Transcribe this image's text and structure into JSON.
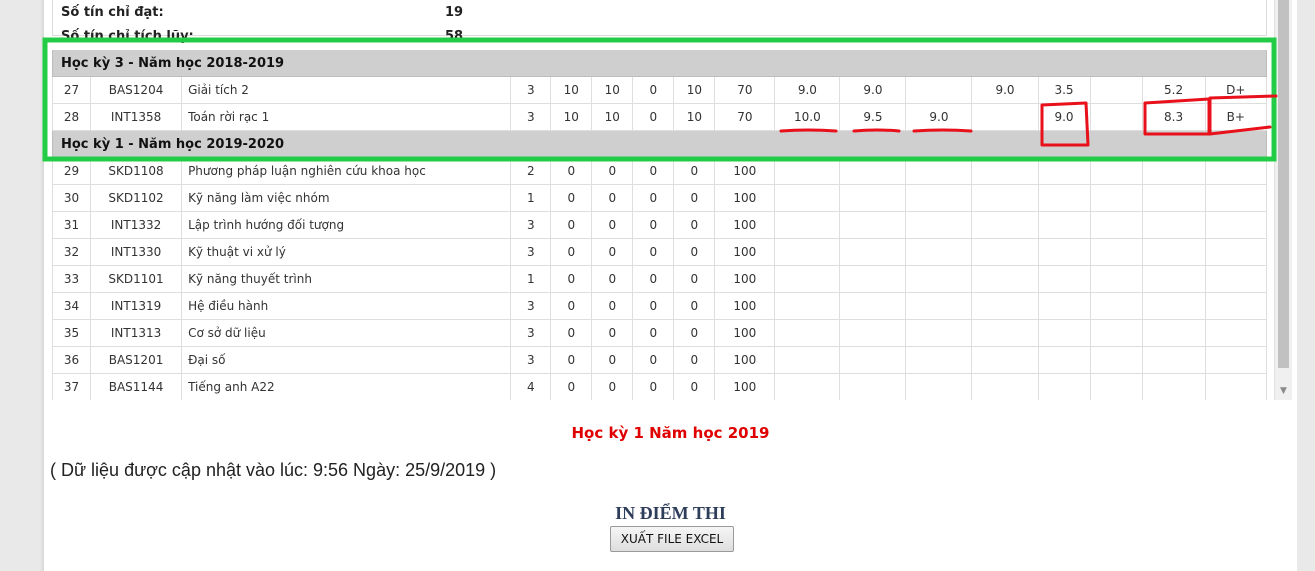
{
  "summary": [
    {
      "label": "Số tín chỉ đạt:",
      "value": "19"
    },
    {
      "label": "Số tín chỉ tích lũy:",
      "value": "58"
    }
  ],
  "semesters": [
    {
      "title": "Học kỳ 3 - Năm học 2018-2019",
      "rows": [
        {
          "stt": "27",
          "code": "BAS1204",
          "name": "Giải tích 2",
          "tc": "3",
          "w1": "10",
          "w2": "10",
          "w3": "0",
          "w4": "10",
          "w5": "70",
          "g1": "9.0",
          "g2": "9.0",
          "g3": "",
          "g4": "9.0",
          "g5": "3.5",
          "g6": "",
          "g7": "5.2",
          "letter": "D+"
        },
        {
          "stt": "28",
          "code": "INT1358",
          "name": "Toán rời rạc 1",
          "tc": "3",
          "w1": "10",
          "w2": "10",
          "w3": "0",
          "w4": "10",
          "w5": "70",
          "g1": "10.0",
          "g2": "9.5",
          "g3": "9.0",
          "g4": "",
          "g5": "9.0",
          "g6": "",
          "g7": "8.3",
          "letter": "B+"
        }
      ]
    },
    {
      "title": "Học kỳ 1 - Năm học 2019-2020",
      "rows": [
        {
          "stt": "29",
          "code": "SKD1108",
          "name": "Phương pháp luận nghiên cứu khoa học",
          "tc": "2",
          "w1": "0",
          "w2": "0",
          "w3": "0",
          "w4": "0",
          "w5": "100",
          "g1": "",
          "g2": "",
          "g3": "",
          "g4": "",
          "g5": "",
          "g6": "",
          "g7": "",
          "letter": ""
        },
        {
          "stt": "30",
          "code": "SKD1102",
          "name": "Kỹ năng làm việc nhóm",
          "tc": "1",
          "w1": "0",
          "w2": "0",
          "w3": "0",
          "w4": "0",
          "w5": "100",
          "g1": "",
          "g2": "",
          "g3": "",
          "g4": "",
          "g5": "",
          "g6": "",
          "g7": "",
          "letter": ""
        },
        {
          "stt": "31",
          "code": "INT1332",
          "name": "Lập trình hướng đối tượng",
          "tc": "3",
          "w1": "0",
          "w2": "0",
          "w3": "0",
          "w4": "0",
          "w5": "100",
          "g1": "",
          "g2": "",
          "g3": "",
          "g4": "",
          "g5": "",
          "g6": "",
          "g7": "",
          "letter": ""
        },
        {
          "stt": "32",
          "code": "INT1330",
          "name": "Kỹ thuật vi xử lý",
          "tc": "3",
          "w1": "0",
          "w2": "0",
          "w3": "0",
          "w4": "0",
          "w5": "100",
          "g1": "",
          "g2": "",
          "g3": "",
          "g4": "",
          "g5": "",
          "g6": "",
          "g7": "",
          "letter": ""
        },
        {
          "stt": "33",
          "code": "SKD1101",
          "name": "Kỹ năng thuyết trình",
          "tc": "1",
          "w1": "0",
          "w2": "0",
          "w3": "0",
          "w4": "0",
          "w5": "100",
          "g1": "",
          "g2": "",
          "g3": "",
          "g4": "",
          "g5": "",
          "g6": "",
          "g7": "",
          "letter": ""
        },
        {
          "stt": "34",
          "code": "INT1319",
          "name": "Hệ điều hành",
          "tc": "3",
          "w1": "0",
          "w2": "0",
          "w3": "0",
          "w4": "0",
          "w5": "100",
          "g1": "",
          "g2": "",
          "g3": "",
          "g4": "",
          "g5": "",
          "g6": "",
          "g7": "",
          "letter": ""
        },
        {
          "stt": "35",
          "code": "INT1313",
          "name": "Cơ sở dữ liệu",
          "tc": "3",
          "w1": "0",
          "w2": "0",
          "w3": "0",
          "w4": "0",
          "w5": "100",
          "g1": "",
          "g2": "",
          "g3": "",
          "g4": "",
          "g5": "",
          "g6": "",
          "g7": "",
          "letter": ""
        },
        {
          "stt": "36",
          "code": "BAS1201",
          "name": "Đại số",
          "tc": "3",
          "w1": "0",
          "w2": "0",
          "w3": "0",
          "w4": "0",
          "w5": "100",
          "g1": "",
          "g2": "",
          "g3": "",
          "g4": "",
          "g5": "",
          "g6": "",
          "g7": "",
          "letter": ""
        },
        {
          "stt": "37",
          "code": "BAS1144",
          "name": "Tiếng anh A22",
          "tc": "4",
          "w1": "0",
          "w2": "0",
          "w3": "0",
          "w4": "0",
          "w5": "100",
          "g1": "",
          "g2": "",
          "g3": "",
          "g4": "",
          "g5": "",
          "g6": "",
          "g7": "",
          "letter": ""
        }
      ]
    }
  ],
  "term_label": "Học kỳ 1 Năm học 2019",
  "update_note": "( Dữ liệu được cập nhật vào lúc: 9:56 Ngày: 25/9/2019 )",
  "print_title": "IN ĐIỂM THI",
  "export_button": "XUẤT FILE EXCEL",
  "scroll_down_icon": "▼",
  "colors": {
    "highlight_box": "#22cc44",
    "annotation_marks": "#e8101a",
    "term_label": "#e00000",
    "semester_header_bg": "#cfcfcf"
  }
}
